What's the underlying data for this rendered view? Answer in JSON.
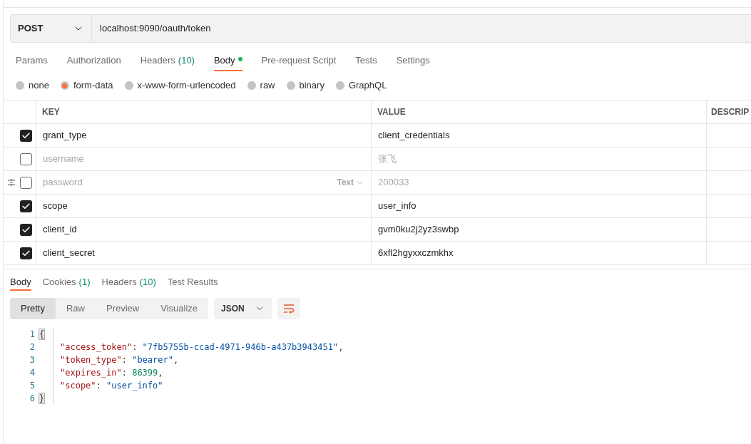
{
  "request": {
    "method": "POST",
    "url": "localhost:9090/oauth/token"
  },
  "request_tabs": [
    {
      "label": "Params",
      "selected": false,
      "modified": false
    },
    {
      "label": "Authorization",
      "selected": false,
      "modified": false
    },
    {
      "label": "Headers",
      "count": "(10)",
      "selected": false,
      "modified": false
    },
    {
      "label": "Body",
      "selected": true,
      "modified": true
    },
    {
      "label": "Pre-request Script",
      "selected": false,
      "modified": false
    },
    {
      "label": "Tests",
      "selected": false,
      "modified": false
    },
    {
      "label": "Settings",
      "selected": false,
      "modified": false
    }
  ],
  "body_types": [
    {
      "label": "none",
      "selected": false
    },
    {
      "label": "form-data",
      "selected": true
    },
    {
      "label": "x-www-form-urlencoded",
      "selected": false
    },
    {
      "label": "raw",
      "selected": false
    },
    {
      "label": "binary",
      "selected": false
    },
    {
      "label": "GraphQL",
      "selected": false
    }
  ],
  "table": {
    "columns": [
      "KEY",
      "VALUE",
      "DESCRIP"
    ],
    "rows": [
      {
        "checked": true,
        "key": "grant_type",
        "value": "client_credentials"
      },
      {
        "checked": false,
        "key": "username",
        "value": "张飞"
      },
      {
        "checked": false,
        "key": "password",
        "value": "200033",
        "type_selector": "Text"
      },
      {
        "checked": true,
        "key": "scope",
        "value": "user_info"
      },
      {
        "checked": true,
        "key": "client_id",
        "value": "gvm0ku2j2yz3swbp"
      },
      {
        "checked": true,
        "key": "client_secret",
        "value": "6xfl2hgyxxczmkhx"
      }
    ]
  },
  "response_tabs": [
    {
      "label": "Body",
      "selected": true
    },
    {
      "label": "Cookies",
      "count": "(1)",
      "selected": false
    },
    {
      "label": "Headers",
      "count": "(10)",
      "selected": false
    },
    {
      "label": "Test Results",
      "selected": false
    }
  ],
  "view_modes": [
    {
      "label": "Pretty",
      "selected": true
    },
    {
      "label": "Raw",
      "selected": false
    },
    {
      "label": "Preview",
      "selected": false
    },
    {
      "label": "Visualize",
      "selected": false
    }
  ],
  "format": "JSON",
  "code": [
    {
      "number": "1",
      "tokens": [
        {
          "kind": "bracket",
          "text": "{"
        }
      ]
    },
    {
      "number": "2",
      "tokens": [
        {
          "kind": "key",
          "text": "\"access_token\""
        },
        {
          "kind": "punct",
          "text": ": "
        },
        {
          "kind": "string",
          "text": "\"7fb5755b-ccad-4971-946b-a437b3943451\""
        },
        {
          "kind": "punct",
          "text": ","
        }
      ]
    },
    {
      "number": "3",
      "tokens": [
        {
          "kind": "key",
          "text": "\"token_type\""
        },
        {
          "kind": "punct",
          "text": ": "
        },
        {
          "kind": "string",
          "text": "\"bearer\""
        },
        {
          "kind": "punct",
          "text": ","
        }
      ]
    },
    {
      "number": "4",
      "tokens": [
        {
          "kind": "key",
          "text": "\"expires_in\""
        },
        {
          "kind": "punct",
          "text": ": "
        },
        {
          "kind": "number",
          "text": "86399"
        },
        {
          "kind": "punct",
          "text": ","
        }
      ]
    },
    {
      "number": "5",
      "tokens": [
        {
          "kind": "key",
          "text": "\"scope\""
        },
        {
          "kind": "punct",
          "text": ": "
        },
        {
          "kind": "string",
          "text": "\"user_info\""
        }
      ]
    },
    {
      "number": "6",
      "tokens": [
        {
          "kind": "bracket",
          "text": "}"
        }
      ]
    }
  ]
}
